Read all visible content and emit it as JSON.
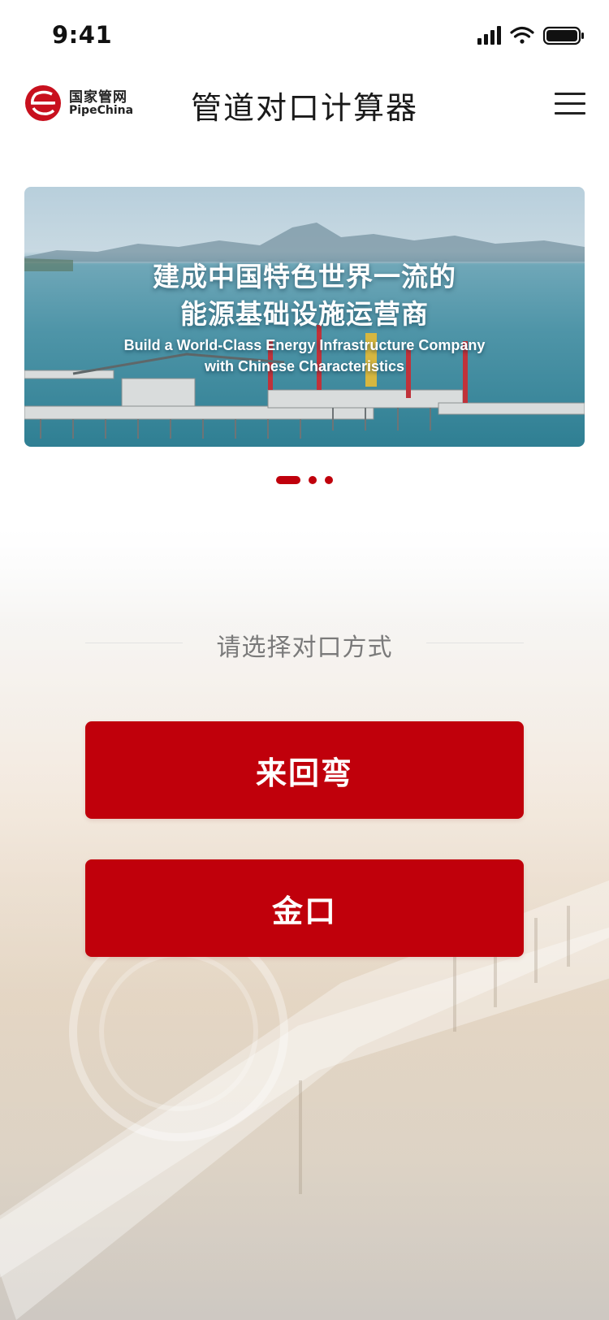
{
  "status_bar": {
    "time": "9:41"
  },
  "header": {
    "logo_cn": "国家管网",
    "logo_en": "PipeChina",
    "title": "管道对口计算器"
  },
  "banner": {
    "headline_line1": "建成中国特色世界一流的",
    "headline_line2": "能源基础设施运营商",
    "subline_line1": "Build a World-Class Energy Infrastructure Company",
    "subline_line2": "with Chinese Characteristics",
    "slides": 3,
    "active_slide": 1
  },
  "section": {
    "label": "请选择对口方式"
  },
  "buttons": [
    {
      "label": "来回弯"
    },
    {
      "label": "金口"
    }
  ],
  "colors": {
    "accent": "#c0000b",
    "title": "#1a1a1a",
    "muted": "#7a7a7a"
  },
  "icons": [
    "signal-icon",
    "wifi-icon",
    "battery-icon",
    "pipechina-logo",
    "menu-icon"
  ]
}
